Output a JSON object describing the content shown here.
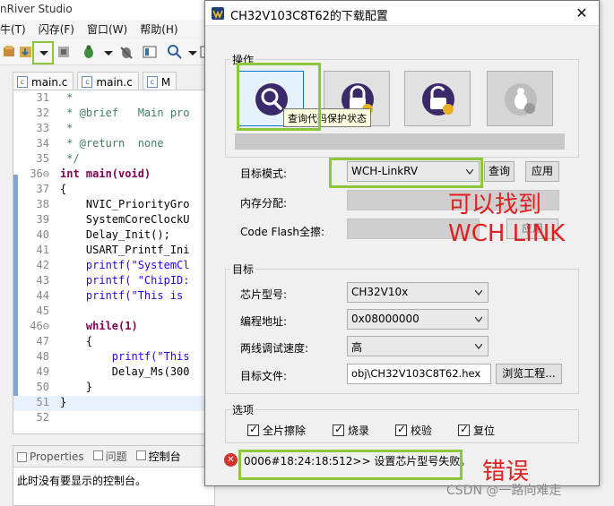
{
  "ide": {
    "title": "nRiver Studio",
    "menu": [
      "牛(T)",
      "闪存(F)",
      "窗口(W)",
      "帮助(H)"
    ],
    "tabs": [
      "main.c",
      "main.c",
      "M"
    ],
    "code_lines": [
      {
        "n": "31",
        "t": " *"
      },
      {
        "n": "32",
        "t": " * @brief   Main pro"
      },
      {
        "n": "33",
        "t": " *"
      },
      {
        "n": "34",
        "t": " * @return  none"
      },
      {
        "n": "35",
        "t": " */"
      },
      {
        "n": "36⊖",
        "t": "int main(void)"
      },
      {
        "n": "37",
        "t": "{"
      },
      {
        "n": "38",
        "t": "    NVIC_PriorityGro"
      },
      {
        "n": "39",
        "t": "    SystemCoreClockU"
      },
      {
        "n": "40",
        "t": "    Delay_Init();"
      },
      {
        "n": "41",
        "t": "    USART_Printf_Ini"
      },
      {
        "n": "42",
        "t": "    printf(\"SystemCl"
      },
      {
        "n": "43",
        "t": "    printf( \"ChipID:"
      },
      {
        "n": "44",
        "t": "    printf(\"This is "
      },
      {
        "n": "45",
        "t": ""
      },
      {
        "n": "46⊖",
        "t": "    while(1)"
      },
      {
        "n": "47",
        "t": "    {"
      },
      {
        "n": "48",
        "t": "        printf(\"This"
      },
      {
        "n": "49",
        "t": "        Delay_Ms(300"
      },
      {
        "n": "50",
        "t": "    }"
      },
      {
        "n": "51",
        "t": "}"
      },
      {
        "n": "52",
        "t": ""
      }
    ],
    "bottom_tabs": [
      "Properties",
      "问题",
      "控制台"
    ],
    "console_message": "此时没有要显示的控制台。"
  },
  "dialog": {
    "title": "CH32V103C8T62的下载配置",
    "close": "✕",
    "ops_group": "操作",
    "tooltip": "查询代码保护状态",
    "target_mode_label": "目标模式:",
    "target_mode_value": "WCH-LinkRV",
    "query_button": "查询",
    "apply_button": "应用",
    "memory_label": "内存分配:",
    "flash_erase_label": "Code Flash全擦:",
    "apply_button2": "应用",
    "target_group": "目标",
    "chip_label": "芯片型号:",
    "chip_value": "CH32V10x",
    "address_label": "编程地址:",
    "address_value": "0x08000000",
    "speed_label": "两线调试速度:",
    "speed_value": "高",
    "file_label": "目标文件:",
    "file_value": "obj\\CH32V103C8T62.hex",
    "browse_button": "浏览工程...",
    "options_group": "选项",
    "options": [
      "全片擦除",
      "烧录",
      "校验",
      "复位"
    ],
    "error_message": "0006#18:24:18:512>> 设置芯片型号失败。"
  },
  "annotations": {
    "find": "可以找到",
    "wch_link": "WCH LINK",
    "error": "错误",
    "watermark": "CSDN @一路向难走"
  },
  "colors": {
    "highlight_green": "#8cc63e",
    "annotation_red": "#e02020",
    "error_red": "#d0342c"
  }
}
